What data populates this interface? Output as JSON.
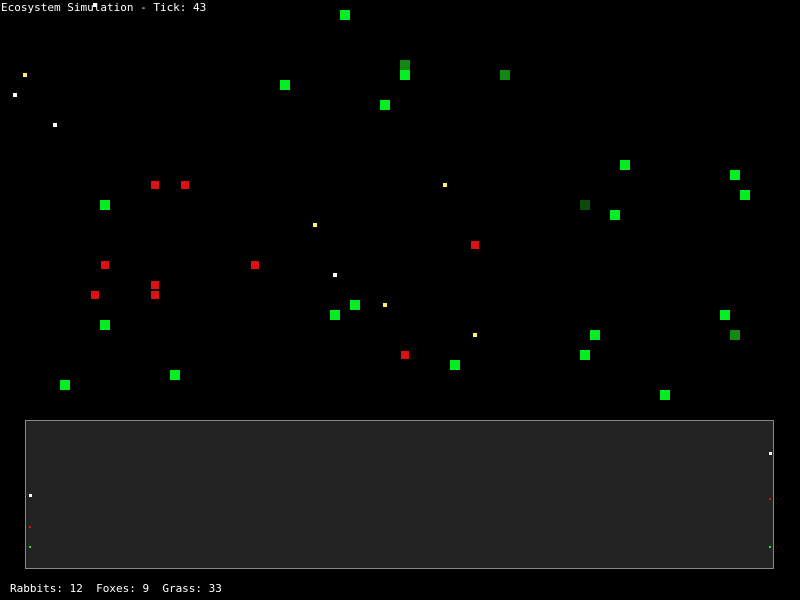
{
  "window": {
    "title": "Ecosystem Simulation - Tick: 43"
  },
  "colors": {
    "background": "#000000",
    "grass_bright": "#00ee22",
    "grass_medium": "#118811",
    "grass_dark": "#0a4a0a",
    "fox": "#dd1111",
    "rabbit_white": "#ffffff",
    "rabbit_yellow": "#ffee66",
    "graph_background": "#222222",
    "graph_border": "#888888"
  },
  "stats": {
    "label": "Rabbits: 12  Foxes: 9  Grass: 33",
    "rabbits": 12,
    "foxes": 9,
    "grass": 33
  },
  "population_graph": {
    "series_colors": [
      "rabbit_white",
      "fox",
      "grass_bright"
    ],
    "legend_marks": "white, red, green markers at left and right edges"
  }
}
